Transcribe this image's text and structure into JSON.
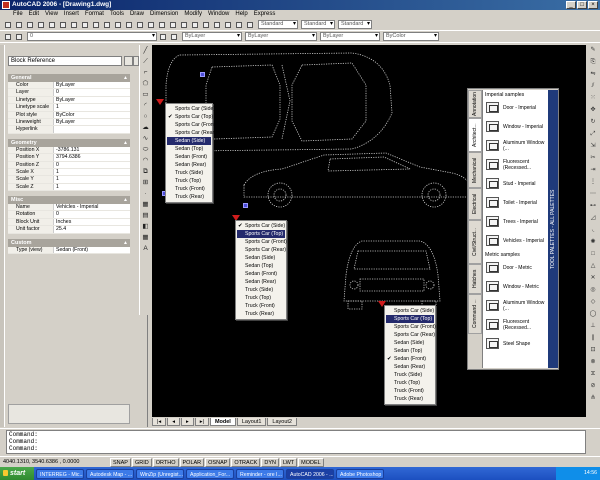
{
  "window": {
    "title": "AutoCAD 2006 - [Drawing1.dwg]",
    "min_label": "_",
    "max_label": "□",
    "close_label": "×"
  },
  "menu": [
    "File",
    "Edit",
    "View",
    "Insert",
    "Format",
    "Tools",
    "Draw",
    "Dimension",
    "Modify",
    "Window",
    "Help",
    "Express"
  ],
  "toolbars": {
    "layer_combo": "0",
    "layer_props": [
      "ByLayer",
      "ByLayer",
      "ByLayer",
      "ByColor"
    ],
    "style_combos": [
      "Standard",
      "Standard",
      "Standard"
    ]
  },
  "properties": {
    "object_type": "Block Reference",
    "categories": [
      {
        "name": "General",
        "rows": [
          {
            "key": "Color",
            "value": "ByLayer"
          },
          {
            "key": "Layer",
            "value": "0"
          },
          {
            "key": "Linetype",
            "value": "ByLayer"
          },
          {
            "key": "Linetype scale",
            "value": "1"
          },
          {
            "key": "Plot style",
            "value": "ByColor"
          },
          {
            "key": "Lineweight",
            "value": "ByLayer"
          },
          {
            "key": "Hyperlink",
            "value": ""
          }
        ]
      },
      {
        "name": "Geometry",
        "rows": [
          {
            "key": "Position X",
            "value": "-3786.131"
          },
          {
            "key": "Position Y",
            "value": "3794.6386"
          },
          {
            "key": "Position Z",
            "value": "0"
          },
          {
            "key": "Scale X",
            "value": "1"
          },
          {
            "key": "Scale Y",
            "value": "1"
          },
          {
            "key": "Scale Z",
            "value": "1"
          }
        ]
      },
      {
        "name": "Misc",
        "rows": [
          {
            "key": "Name",
            "value": "Vehicles - Imperial"
          },
          {
            "key": "Rotation",
            "value": "0"
          },
          {
            "key": "Block Unit",
            "value": "Inches"
          },
          {
            "key": "Unit factor",
            "value": "25.4"
          }
        ]
      },
      {
        "name": "Custom",
        "rows": [
          {
            "key": "Type (view)",
            "value": "Sedan (Front)"
          }
        ]
      }
    ]
  },
  "popups": [
    {
      "items": [
        "Sports Car (Side)",
        "Sports Car (Top)",
        "Sports Car (Front)",
        "Sports Car (Rear)",
        "Sedan (Side)",
        "Sedan (Top)",
        "Sedan (Front)",
        "Sedan (Rear)",
        "Truck (Side)",
        "Truck (Top)",
        "Truck (Front)",
        "Truck (Rear)"
      ],
      "checked": 1,
      "highlighted": 4
    },
    {
      "items": [
        "Sports Car (Side)",
        "Sports Car (Top)",
        "Sports Car (Front)",
        "Sports Car (Rear)",
        "Sedan (Side)",
        "Sedan (Top)",
        "Sedan (Front)",
        "Sedan (Rear)",
        "Truck (Side)",
        "Truck (Top)",
        "Truck (Front)",
        "Truck (Rear)"
      ],
      "checked": 0,
      "highlighted": 1
    },
    {
      "items": [
        "Sports Car (Side)",
        "Sports Car (Top)",
        "Sports Car (Front)",
        "Sports Car (Rear)",
        "Sedan (Side)",
        "Sedan (Top)",
        "Sedan (Front)",
        "Sedan (Rear)",
        "Truck (Side)",
        "Truck (Top)",
        "Truck (Front)",
        "Truck (Rear)"
      ],
      "checked": 6,
      "highlighted": 1
    }
  ],
  "palette": {
    "tabs": [
      "Annotation",
      "Architect...",
      "Mechanical",
      "Electrical",
      "Civil/Struct...",
      "Hatches",
      "Command ..."
    ],
    "active_tab": 1,
    "section1": "Imperial samples",
    "items1": [
      "Door - Imperial",
      "Window - Imperial",
      "Aluminum Window (...",
      "Fluorescent (Recessed...",
      "Stud - Imperial",
      "Toilet - Imperial",
      "Trees - Imperial",
      "Vehicles - Imperial"
    ],
    "section2": "Metric samples",
    "items2": [
      "Door - Metric",
      "Window - Metric",
      "Aluminum Window (...",
      "Fluorescent (Recessed...",
      "Steel Shape"
    ],
    "title": "TOOL PALETTES - ALL PALETTES"
  },
  "layout_tabs": [
    "Model",
    "Layout1",
    "Layout2"
  ],
  "command": {
    "lines": [
      "Command:",
      "Command:",
      "Command:"
    ]
  },
  "status": {
    "coords": "4040.1310, 3540.6386 , 0.0000",
    "buttons": [
      "SNAP",
      "GRID",
      "ORTHO",
      "POLAR",
      "OSNAP",
      "OTRACK",
      "DYN",
      "LWT",
      "MODEL"
    ]
  },
  "taskbar": {
    "start": "start",
    "tasks": [
      "INTERREG - Mic...",
      "Autodesk Map - ...",
      "WinZip (Unregist...",
      "Application_For...",
      "Reminder - ore I...",
      "AutoCAD 2006 - ...",
      "Adobe Photoshop"
    ],
    "active": 5,
    "clock": "14:56"
  },
  "colors": {
    "highlight": "#242a6c",
    "grip": "#4c4cd6",
    "arrow": "#d01c1c",
    "canvas": "#000000"
  }
}
